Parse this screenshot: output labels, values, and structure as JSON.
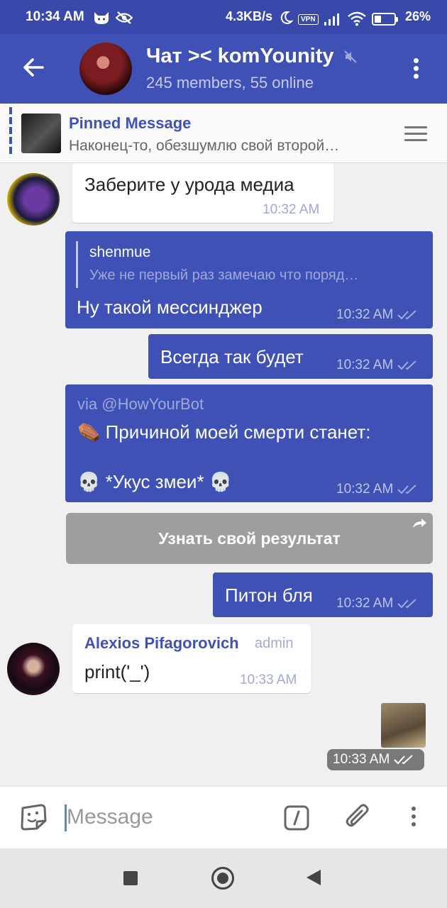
{
  "status_bar": {
    "time": "10:34 AM",
    "network_speed": "4.3KB/s",
    "vpn_label": "VPN",
    "battery_percent": "26%",
    "icons": [
      "cat-icon",
      "eye-off-icon",
      "moon-icon",
      "vpn-icon",
      "signal-icon",
      "wifi-icon",
      "battery-icon"
    ]
  },
  "header": {
    "title": "Чат >< komYounity",
    "subtitle": "245 members, 55 online",
    "muted": true
  },
  "pinned": {
    "title": "Pinned Message",
    "text": "Наконец-то, обезшумлю свой второй…"
  },
  "messages": [
    {
      "direction": "in",
      "text": "Заберите у урода медиа",
      "time": "10:32 AM"
    },
    {
      "direction": "out",
      "reply_to_name": "shenmue",
      "reply_to_text": "Уже не первый раз замечаю что поряд…",
      "text": "Ну такой мессинджер",
      "time": "10:32 AM"
    },
    {
      "direction": "out",
      "text": "Всегда так будет",
      "time": "10:32 AM"
    },
    {
      "direction": "out",
      "via": "via @HowYourBot",
      "line1": "⚰️ Причиной моей смерти станет:",
      "line2": "💀 *Укус змеи* 💀",
      "time": "10:32 AM",
      "inline_button": "Узнать свой результат"
    },
    {
      "direction": "out",
      "text": "Питон бля",
      "time": "10:32 AM"
    },
    {
      "direction": "in",
      "sender": "Alexios Pifagorovich",
      "sender_role": "admin",
      "text": "print('_')",
      "time": "10:33 AM"
    },
    {
      "direction": "out",
      "type": "sticker",
      "time": "10:33 AM"
    }
  ],
  "composer": {
    "placeholder": "Message",
    "value": ""
  },
  "colors": {
    "primary": "#3f51b5",
    "status_bar": "#3949ab",
    "outgoing_bubble": "#3f51b5",
    "incoming_bubble": "#ffffff",
    "chat_background": "#f0f0f0"
  }
}
